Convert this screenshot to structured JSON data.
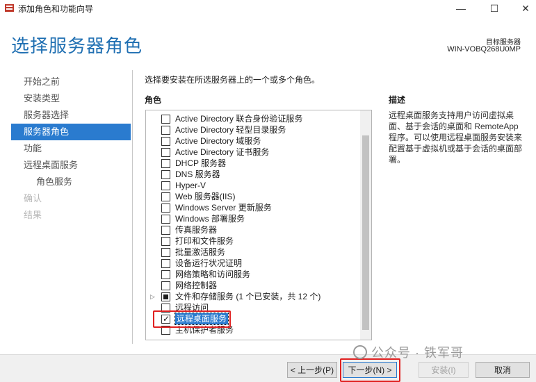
{
  "window": {
    "title": "添加角色和功能向导",
    "minimize_glyph": "—",
    "maximize_glyph": "☐",
    "close_glyph": "✕"
  },
  "header": {
    "page_title": "选择服务器角色",
    "target_label": "目标服务器",
    "target_name": "WIN-VOBQ268U0MP"
  },
  "nav": {
    "items": [
      {
        "label": "开始之前",
        "state": "normal"
      },
      {
        "label": "安装类型",
        "state": "normal"
      },
      {
        "label": "服务器选择",
        "state": "normal"
      },
      {
        "label": "服务器角色",
        "state": "active"
      },
      {
        "label": "功能",
        "state": "normal"
      },
      {
        "label": "远程桌面服务",
        "state": "normal"
      },
      {
        "label": "角色服务",
        "state": "sub"
      },
      {
        "label": "确认",
        "state": "disabled"
      },
      {
        "label": "结果",
        "state": "disabled"
      }
    ]
  },
  "main": {
    "instruction": "选择要安装在所选服务器上的一个或多个角色。",
    "roles_heading": "角色",
    "description_heading": "描述",
    "description_text": "远程桌面服务支持用户访问虚拟桌面、基于会话的桌面和 RemoteApp 程序。可以使用远程桌面服务安装来配置基于虚拟机或基于会话的桌面部署。",
    "roles": [
      {
        "label": "Active Directory 联合身份验证服务",
        "state": "unchecked",
        "expandable": false
      },
      {
        "label": "Active Directory 轻型目录服务",
        "state": "unchecked",
        "expandable": false
      },
      {
        "label": "Active Directory 域服务",
        "state": "unchecked",
        "expandable": false
      },
      {
        "label": "Active Directory 证书服务",
        "state": "unchecked",
        "expandable": false
      },
      {
        "label": "DHCP 服务器",
        "state": "unchecked",
        "expandable": false
      },
      {
        "label": "DNS 服务器",
        "state": "unchecked",
        "expandable": false
      },
      {
        "label": "Hyper-V",
        "state": "unchecked",
        "expandable": false
      },
      {
        "label": "Web 服务器(IIS)",
        "state": "unchecked",
        "expandable": false
      },
      {
        "label": "Windows Server 更新服务",
        "state": "unchecked",
        "expandable": false
      },
      {
        "label": "Windows 部署服务",
        "state": "unchecked",
        "expandable": false
      },
      {
        "label": "传真服务器",
        "state": "unchecked",
        "expandable": false
      },
      {
        "label": "打印和文件服务",
        "state": "unchecked",
        "expandable": false
      },
      {
        "label": "批量激活服务",
        "state": "unchecked",
        "expandable": false
      },
      {
        "label": "设备运行状况证明",
        "state": "unchecked",
        "expandable": false
      },
      {
        "label": "网络策略和访问服务",
        "state": "unchecked",
        "expandable": false
      },
      {
        "label": "网络控制器",
        "state": "unchecked",
        "expandable": false
      },
      {
        "label": "文件和存储服务 (1 个已安装，共 12 个)",
        "state": "partial",
        "expandable": true
      },
      {
        "label": "远程访问",
        "state": "unchecked",
        "expandable": false
      },
      {
        "label": "远程桌面服务",
        "state": "checked",
        "expandable": false,
        "selected": true
      },
      {
        "label": "主机保护者服务",
        "state": "unchecked",
        "expandable": false
      }
    ]
  },
  "footer": {
    "prev_label": "< 上一步(P)",
    "next_label": "下一步(N) >",
    "install_label": "安装(I)",
    "cancel_label": "取消"
  },
  "watermark": {
    "text": "公众号 · 铁军哥"
  },
  "colors": {
    "accent": "#2a7bcf",
    "title": "#1f6fb2",
    "highlight": "#e02020"
  }
}
